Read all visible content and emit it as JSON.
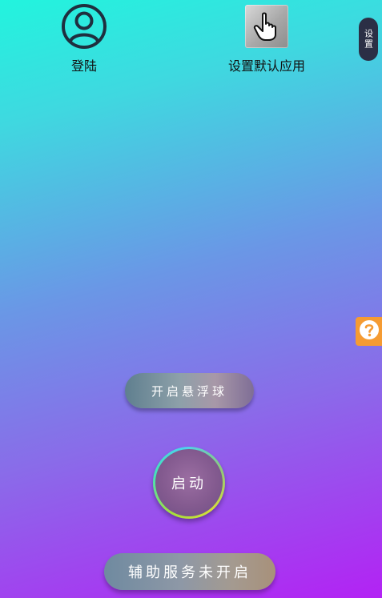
{
  "header": {
    "login_label": "登陆",
    "default_app_label": "设置默认应用",
    "settings_label": "设置"
  },
  "actions": {
    "floating_ball_label": "开启悬浮球",
    "start_label": "启动",
    "accessibility_status_label": "辅助服务未开启"
  },
  "icons": {
    "login": "user-circle-icon",
    "default_app": "hand-pointer-icon",
    "help": "question-circle-icon"
  },
  "colors": {
    "gradient_top": "#22f4de",
    "gradient_bottom": "#b322f4",
    "help_tab": "#f59b32",
    "settings_pill": "#2b2f45"
  }
}
